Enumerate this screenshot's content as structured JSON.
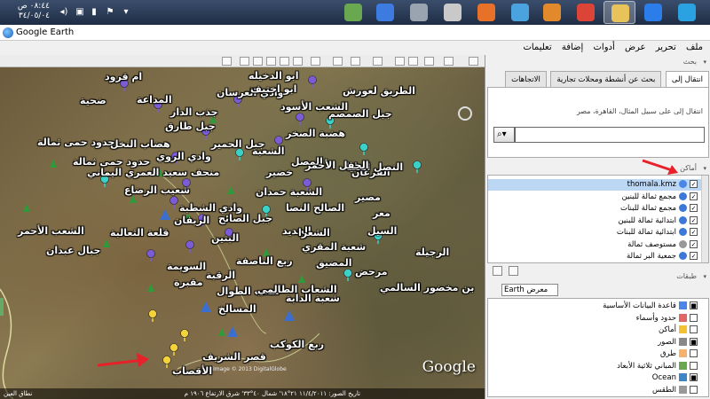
{
  "taskbar": {
    "clock_time": "٠٨:٤٤ ص",
    "clock_date": "٣٤/٠٥/٠٤",
    "apps": [
      {
        "name": "notepad-app",
        "color": "#6aa84f"
      },
      {
        "name": "google-earth-app",
        "color": "#3d7be0"
      },
      {
        "name": "phone-app",
        "color": "#9aa4b0"
      },
      {
        "name": "disk-app",
        "color": "#c9c9c9"
      },
      {
        "name": "firefox-app",
        "color": "#e8712a"
      },
      {
        "name": "wifi-app",
        "color": "#4aa3df"
      },
      {
        "name": "media-app",
        "color": "#e28a2b"
      },
      {
        "name": "chrome-app",
        "color": "#db4437"
      },
      {
        "name": "folder-app",
        "color": "#e8c35a"
      },
      {
        "name": "ie-app",
        "color": "#2b7de9"
      },
      {
        "name": "windows-app",
        "color": "#2aa1e0"
      }
    ]
  },
  "window": {
    "title": "Google Earth"
  },
  "menu": [
    "ملف",
    "تحرير",
    "عرض",
    "أدوات",
    "إضافة",
    "تعليمات"
  ],
  "search": {
    "section_title": "بحث",
    "tabs": [
      "انتقال إلى",
      "بحث عن أنشطة ومحلات تجارية",
      "الاتجاهات"
    ],
    "hint": "انتقال إلى على سبيل المثال، القاهرة، مصر",
    "input_value": ""
  },
  "places": {
    "section_title": "أماكن",
    "items": [
      {
        "label": "thomala.kmz",
        "selected": true,
        "icon_color": "#4a86e8"
      },
      {
        "label": "مجمع ثمالة للبنين",
        "selected": false,
        "icon_color": "#3c78d8"
      },
      {
        "label": "مجمع ثمالة للبنات",
        "selected": false,
        "icon_color": "#3c78d8"
      },
      {
        "label": "ابتدائية ثمالة للبنين",
        "selected": false,
        "icon_color": "#3c78d8"
      },
      {
        "label": "ابتدائية ثمالة للبنات",
        "selected": false,
        "icon_color": "#3c78d8"
      },
      {
        "label": "مستوصف ثمالة",
        "selected": false,
        "icon_color": "#999999"
      },
      {
        "label": "جمعية البر ثمالة",
        "selected": false,
        "icon_color": "#3c78d8"
      }
    ]
  },
  "layers": {
    "section_title": "طبقات",
    "combo_value": "Earth معرض",
    "items": [
      {
        "label": "قاعدة البيانات الأساسية",
        "icon_color": "#4a86e8"
      },
      {
        "label": "حدود وأسماء",
        "icon_color": "#e06666"
      },
      {
        "label": "أماكن",
        "icon_color": "#f1c232"
      },
      {
        "label": "الصور",
        "icon_color": "#888888"
      },
      {
        "label": "طرق",
        "icon_color": "#f6b26b"
      },
      {
        "label": "المباني ثلاثية الأبعاد",
        "icon_color": "#6aa84f"
      },
      {
        "label": "Ocean",
        "icon_color": "#3d85c6"
      },
      {
        "label": "الطقس",
        "icon_color": "#999999"
      }
    ]
  },
  "map": {
    "labels": [
      {
        "text": "ابو الدخيله"
      },
      {
        "text": "ام قرود"
      },
      {
        "text": "الطريق لعورش"
      },
      {
        "text": "وادي العرسان"
      },
      {
        "text": "ابو اختيف"
      },
      {
        "text": "ضحية"
      },
      {
        "text": "المداعة"
      },
      {
        "text": "الشعب الأسود"
      },
      {
        "text": "جذب الدار"
      },
      {
        "text": "جبل الصمصم"
      },
      {
        "text": "جبل طارق"
      },
      {
        "text": "هضبة الصخر"
      },
      {
        "text": "حدود حمى ثمالة"
      },
      {
        "text": "هضاب النخل"
      },
      {
        "text": "جبل الحمير"
      },
      {
        "text": "الشعبة"
      },
      {
        "text": "حدود حمى ثمالة"
      },
      {
        "text": "وادي الروي"
      },
      {
        "text": "المصل"
      },
      {
        "text": "منحف سعيد العمري اليماني"
      },
      {
        "text": "خضير"
      },
      {
        "text": "الفرعان"
      },
      {
        "text": "النصل العليا"
      },
      {
        "text": "الحفل الأحمر"
      },
      {
        "text": "شعيب الرضاع"
      },
      {
        "text": "الشعبة حمدان"
      },
      {
        "text": "مصير"
      },
      {
        "text": "وادي الشطبة"
      },
      {
        "text": "الصالح النصا"
      },
      {
        "text": "معر"
      },
      {
        "text": "الريفان"
      },
      {
        "text": "جبل الصائح"
      },
      {
        "text": "الجديد"
      },
      {
        "text": "الشعرا"
      },
      {
        "text": "السيل"
      },
      {
        "text": "الشعب الأحمر"
      },
      {
        "text": "قلعة الثعالبة"
      },
      {
        "text": "البتين"
      },
      {
        "text": "شعبة المقري"
      },
      {
        "text": "الرجيلة"
      },
      {
        "text": "جبال عبدان"
      },
      {
        "text": "ربع الناصفة"
      },
      {
        "text": "مرحض"
      },
      {
        "text": "السويمة"
      },
      {
        "text": "المضيق"
      },
      {
        "text": "الرقبة"
      },
      {
        "text": "مقبرة"
      },
      {
        "text": "شعب الطوال"
      },
      {
        "text": "الشعاب الطالمي"
      },
      {
        "text": "بن مخضور السالمي"
      },
      {
        "text": "شعبة الدابة"
      },
      {
        "text": "المسالخ"
      },
      {
        "text": "ربع الكوكب"
      },
      {
        "text": "قصر الشريف"
      },
      {
        "text": "الأقصاب"
      }
    ],
    "google_logo": "Google",
    "image_credit": "Image © 2013 DigitalGlobe",
    "status_right": "تاريخ الصور: ١١/٤/٢٠١١  ٢١°١٨' شمال  ٤٠°٣٣' شرق  الارتفاع ١٩٠٦ م",
    "status_left": "نطاق العين"
  }
}
